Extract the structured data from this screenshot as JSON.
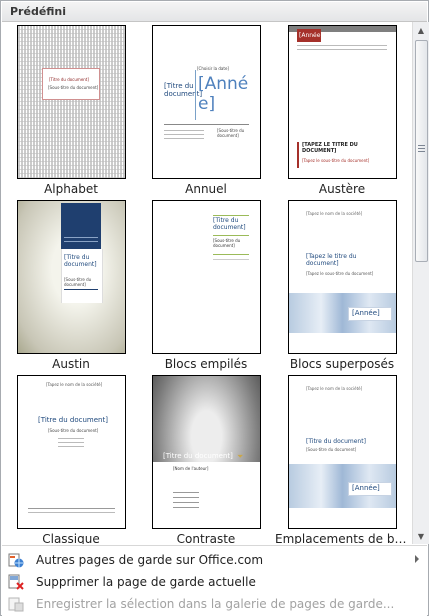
{
  "header": {
    "title": "Prédéfini"
  },
  "tiles": [
    {
      "label": "Alphabet",
      "texts": [
        "[Titre du document]",
        "[Sous-titre du document]"
      ]
    },
    {
      "label": "Annuel",
      "texts": [
        "[Choisir la date]",
        "[Titre du document]",
        "[Anné e]",
        "[Sous-titre du document]"
      ]
    },
    {
      "label": "Austère",
      "texts": [
        "[Année]",
        "[TAPEZ LE TITRE DU DOCUMENT]",
        "[Tapez le sous-titre du document]"
      ]
    },
    {
      "label": "Austin",
      "texts": [
        "[Titre du document]",
        "[Sous-titre du document]"
      ]
    },
    {
      "label": "Blocs empilés",
      "texts": [
        "[Titre du document]",
        "[Sous-titre du document]"
      ]
    },
    {
      "label": "Blocs superposés",
      "texts": [
        "[Tapez le nom de la société]",
        "[Tapez le titre du document]",
        "[Tapez le sous-titre du document]",
        "[Année]"
      ]
    },
    {
      "label": "Classique",
      "texts": [
        "[Tapez le nom de la société]",
        "[Titre du document]",
        "[Sous-titre du document]"
      ]
    },
    {
      "label": "Contraste",
      "texts": [
        "[Titre du document]",
        "[Nom de l'auteur]"
      ]
    },
    {
      "label": "Emplacements de bureau",
      "texts": [
        "[Tapez le nom de la société]",
        "[Titre du document]",
        "[Sous-titre du document]",
        "[Année]"
      ]
    }
  ],
  "menu": [
    {
      "label": "Autres pages de garde sur Office.com",
      "icon": "office-globe-icon",
      "enabled": true,
      "submenu": true
    },
    {
      "label": "Supprimer la page de garde actuelle",
      "icon": "delete-page-icon",
      "enabled": true,
      "submenu": false
    },
    {
      "label": "Enregistrer la sélection dans la galerie de pages de garde...",
      "icon": "save-selection-icon",
      "enabled": false,
      "submenu": false
    }
  ],
  "colors": {
    "accent_red": "#a5302a",
    "title_blue": "#1f497d",
    "selection": "#e7b65a"
  }
}
